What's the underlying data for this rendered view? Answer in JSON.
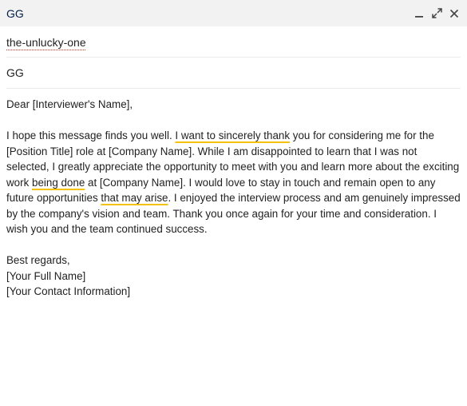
{
  "window": {
    "title": "GG",
    "minimize_icon": "minimize-icon",
    "popout_icon": "expand-icon",
    "close_icon": "close-icon"
  },
  "compose": {
    "to_value": "the-unlucky-one",
    "subject_value": "GG"
  },
  "message": {
    "greeting": "Dear [Interviewer's Name],",
    "para1": [
      {
        "t": "I hope this message finds you well. ",
        "hl": false
      },
      {
        "t": "I want to sincerely thank",
        "hl": true
      },
      {
        "t": " you for considering me for the [Position Title] role at [Company Name]. While I am disappointed to learn that I was not selected, I greatly appreciate the opportunity to meet with you and learn more about the exciting work ",
        "hl": false
      },
      {
        "t": "being done",
        "hl": true
      },
      {
        "t": " at [Company Name].  I would love to stay in touch and remain open to any future opportunities ",
        "hl": false
      },
      {
        "t": "that may arise",
        "hl": true
      },
      {
        "t": ". I enjoyed the interview process and am genuinely impressed by the company's vision and team.  Thank you once again for your time and consideration. I wish you and the team continued success.",
        "hl": false
      }
    ],
    "closing": "Best regards,",
    "signature_name": "[Your Full Name]",
    "signature_contact": "[Your Contact Information]"
  },
  "colors": {
    "titlebar_bg": "#f2f2f2",
    "title_text": "#041e49",
    "grammar_underline": "#f4c20d",
    "spell_underline": "#d93025"
  }
}
